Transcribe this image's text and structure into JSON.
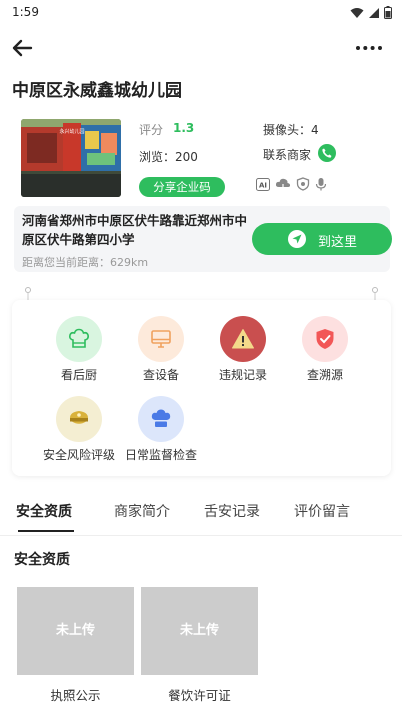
{
  "status_bar": {
    "time": "1:59"
  },
  "page_title": "中原区永威鑫城幼儿园",
  "store": {
    "score_label": "评分",
    "score_value": "1.3",
    "views": "浏览：200",
    "cameras": "摄像头：4",
    "contact_label": "联系商家",
    "share_button": "分享企业码",
    "feature_icons": [
      "ai-icon",
      "cloud-icon",
      "shield-badge-icon",
      "microphone-icon"
    ],
    "photo_banner_text": "永兴幼儿园"
  },
  "address": {
    "text": "河南省郑州市中原区伏牛路靠近郑州市中原区伏牛路第四小学",
    "distance": "距离您当前距离：629km",
    "go_button": "到这里"
  },
  "services": [
    {
      "label": "看后厨",
      "icon": "chef-hat-icon",
      "color": "#d9f5e0"
    },
    {
      "label": "查设备",
      "icon": "monitor-icon",
      "color": "#fdeadb"
    },
    {
      "label": "违规记录",
      "icon": "warning-icon",
      "color": "#c94f4f"
    },
    {
      "label": "查溯源",
      "icon": "shield-check-icon",
      "color": "#fde0e0"
    },
    {
      "label": "安全风险评级",
      "icon": "police-cap-icon",
      "color": "#f4eed2"
    },
    {
      "label": "日常监督检查",
      "icon": "chef-hat-blue-icon",
      "color": "#dce6fb"
    }
  ],
  "tabs": [
    "安全资质",
    "商家简介",
    "舌安记录",
    "评价留言"
  ],
  "active_tab": "安全资质",
  "section_title": "安全资质",
  "documents": [
    {
      "status": "未上传",
      "caption": "执照公示"
    },
    {
      "status": "未上传",
      "caption": "餐饮许可证"
    }
  ],
  "colors": {
    "accent": "#2ebd5e",
    "placeholder": "#cccccc"
  }
}
